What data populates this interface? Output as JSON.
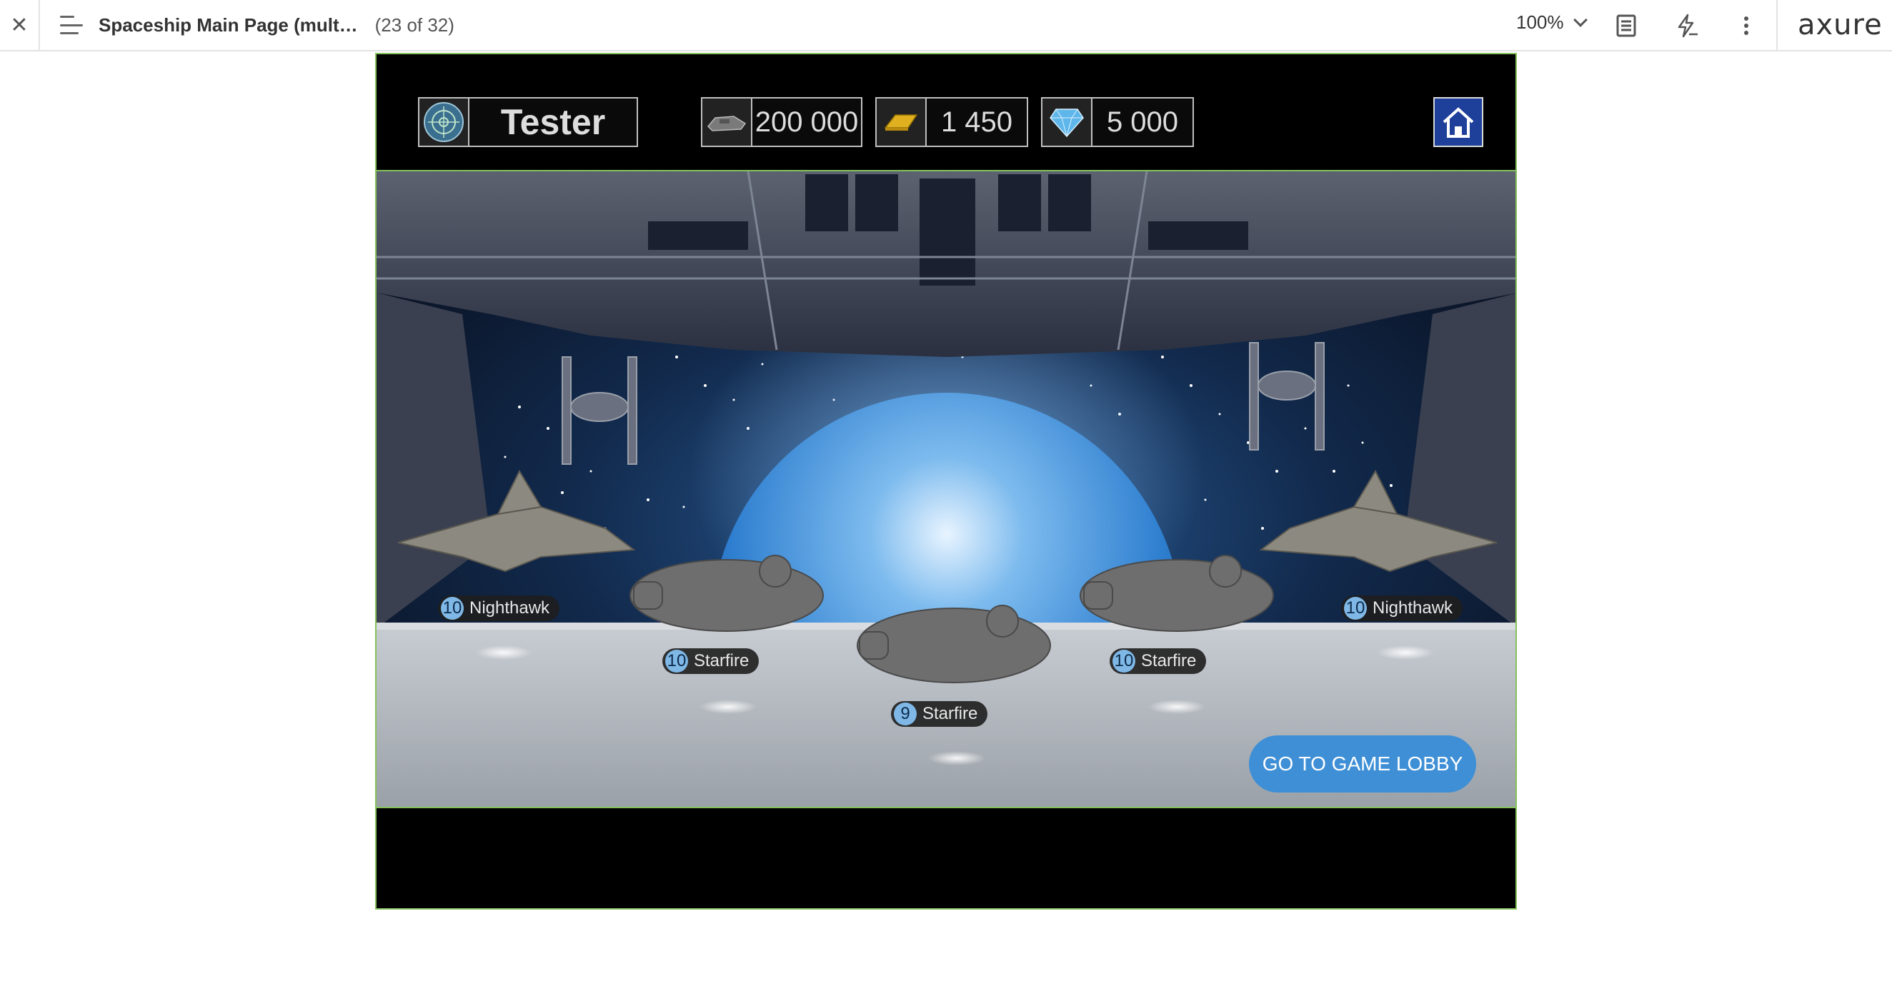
{
  "topbar": {
    "close_glyph": "✕",
    "page_title": "Spaceship Main Page (mult…",
    "page_count": "(23 of 32)",
    "zoom": "100%",
    "brand": "axure",
    "icons": [
      "close-icon",
      "menu-icon",
      "chevron-down-icon",
      "document-icon",
      "lightning-icon",
      "more-vertical-icon"
    ]
  },
  "hud": {
    "player_name": "Tester",
    "ships_value": "200 000",
    "gold_value": "1 450",
    "diamonds_value": "5 000",
    "icons": [
      "avatar-icon",
      "spaceship-icon",
      "gold-bar-icon",
      "diamond-icon",
      "home-icon"
    ]
  },
  "ships": [
    {
      "level": "10",
      "name": "Nighthawk"
    },
    {
      "level": "10",
      "name": "Starfire"
    },
    {
      "level": "9",
      "name": "Starfire"
    },
    {
      "level": "10",
      "name": "Starfire"
    },
    {
      "level": "10",
      "name": "Nighthawk"
    }
  ],
  "lobby_button": "GO TO GAME LOBBY",
  "colors": {
    "frame_border": "#86c25c",
    "home_button": "#1e3f9a",
    "lobby_button": "#3e8fd6",
    "level_badge": "#7fb8e6",
    "planet": "#2f7fd0"
  }
}
